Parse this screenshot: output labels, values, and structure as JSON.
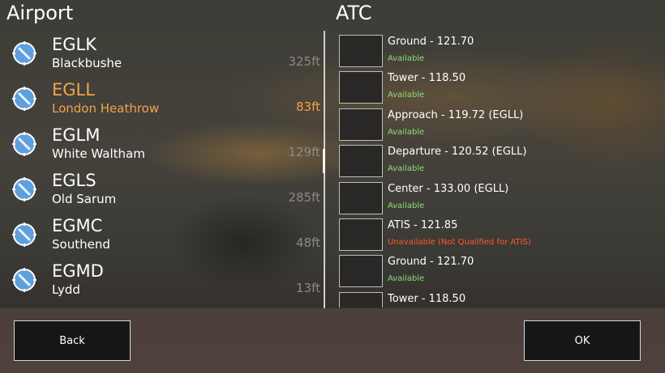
{
  "headers": {
    "airport": "Airport",
    "atc": "ATC"
  },
  "airports": [
    {
      "code": "EGLK",
      "name": "Blackbushe",
      "elevation": "325ft",
      "selected": false,
      "icon": "compass-icon"
    },
    {
      "code": "EGLL",
      "name": "London Heathrow",
      "elevation": "83ft",
      "selected": true,
      "icon": "compass-icon"
    },
    {
      "code": "EGLM",
      "name": "White Waltham",
      "elevation": "129ft",
      "selected": false,
      "icon": "compass-icon"
    },
    {
      "code": "EGLS",
      "name": "Old Sarum",
      "elevation": "285ft",
      "selected": false,
      "icon": "compass-icon"
    },
    {
      "code": "EGMC",
      "name": "Southend",
      "elevation": "48ft",
      "selected": false,
      "icon": "compass-icon"
    },
    {
      "code": "EGMD",
      "name": "Lydd",
      "elevation": "13ft",
      "selected": false,
      "icon": "compass-icon"
    }
  ],
  "atc": [
    {
      "label": "Ground - 121.70",
      "status": "Available",
      "available": true
    },
    {
      "label": "Tower - 118.50",
      "status": "Available",
      "available": true
    },
    {
      "label": "Approach - 119.72 (EGLL)",
      "status": "Available",
      "available": true
    },
    {
      "label": "Departure - 120.52 (EGLL)",
      "status": "Available",
      "available": true
    },
    {
      "label": "Center - 133.00 (EGLL)",
      "status": "Available",
      "available": true
    },
    {
      "label": "ATIS - 121.85",
      "status": "Unavailable (Not Qualified for ATIS)",
      "available": false
    },
    {
      "label": "Ground - 121.70",
      "status": "Available",
      "available": true
    },
    {
      "label": "Tower - 118.50",
      "status": "",
      "available": true
    }
  ],
  "buttons": {
    "back": "Back",
    "ok": "OK"
  },
  "colors": {
    "selected": "#f0a44c",
    "available": "#8ddc75",
    "unavailable": "#ff5a28",
    "elevation": "#8d8a83"
  }
}
